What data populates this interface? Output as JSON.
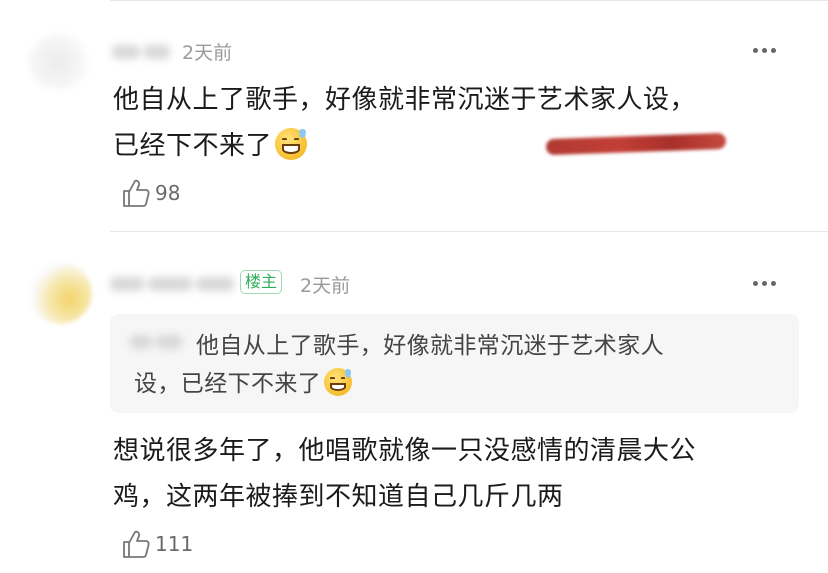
{
  "comments": [
    {
      "time": "2天前",
      "text_line1": "他自从上了歌手，好像就非常沉迷于艺术家人设，",
      "text_line2": "已经下不来了",
      "emoji": "grinning-sweat-emoji",
      "likes": "98"
    },
    {
      "badge": "楼主",
      "time": "2天前",
      "quote_line1": "他自从上了歌手，好像就非常沉迷于艺术家人",
      "quote_line2": "设，已经下不来了",
      "quote_emoji": "grinning-sweat-emoji",
      "text_line1": "想说很多年了，他唱歌就像一只没感情的清晨大公",
      "text_line2": "鸡，这两年被捧到不知道自己几斤几两",
      "likes": "111"
    }
  ],
  "icons": {
    "more": "more-dots-icon",
    "like": "thumbs-up-icon"
  },
  "colors": {
    "badge_green": "#2fae5a",
    "redaction_red": "#b83a32",
    "quote_bg": "#f6f6f6"
  }
}
